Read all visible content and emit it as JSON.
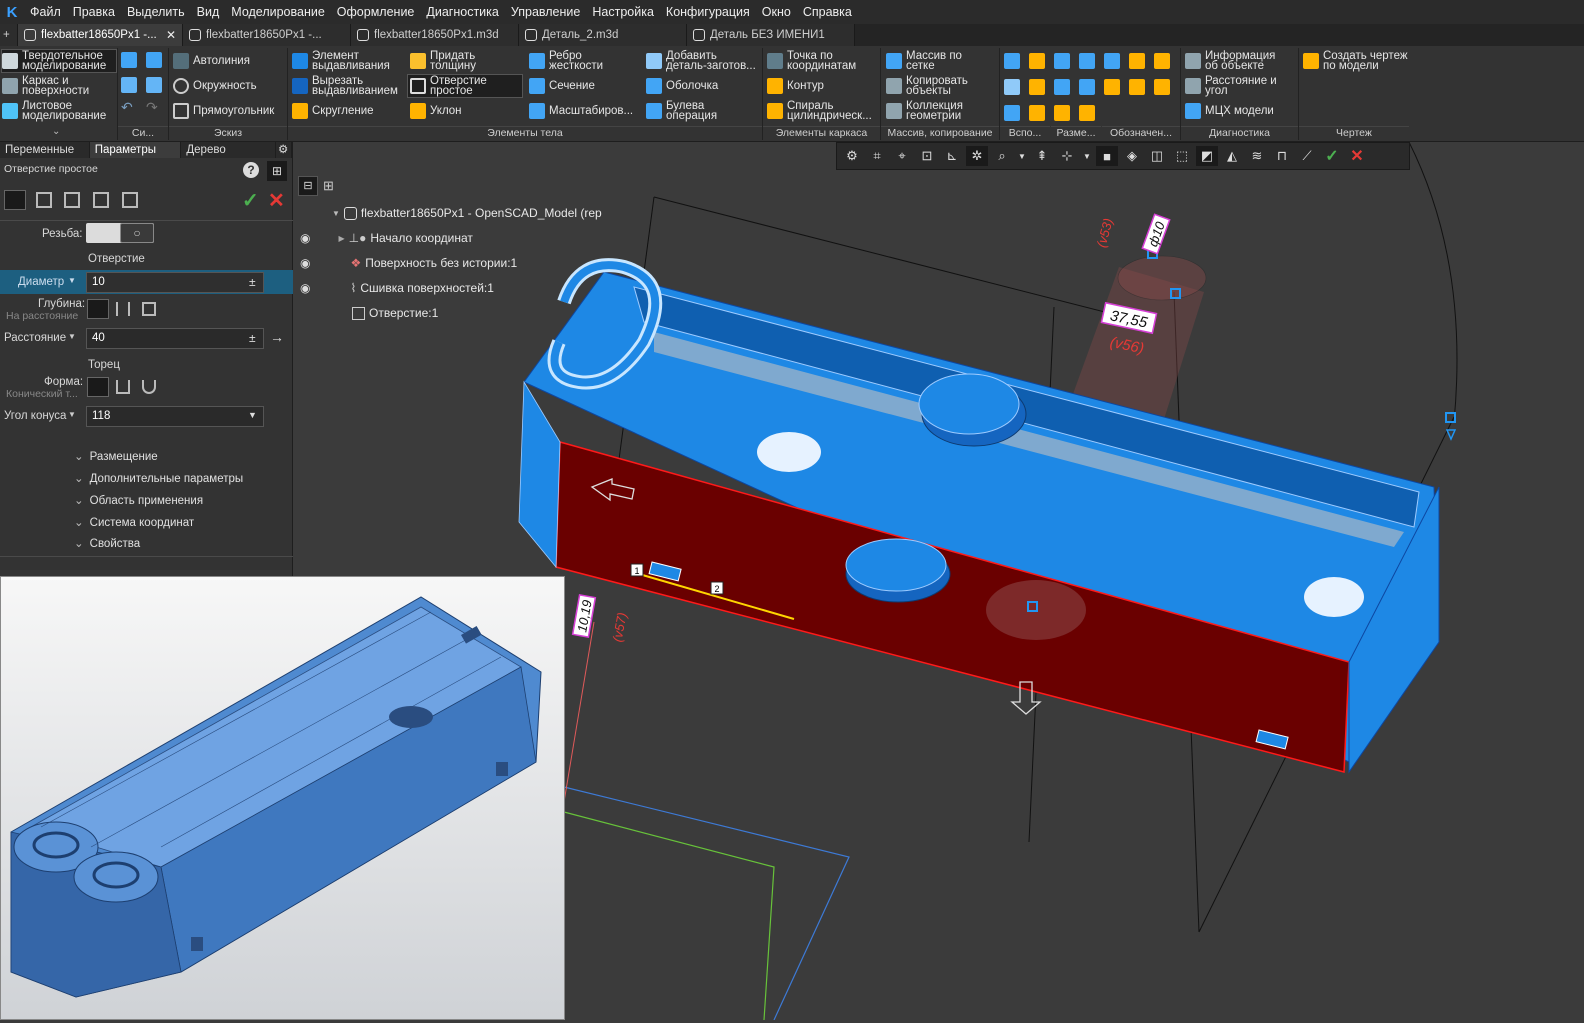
{
  "menu": [
    "Файл",
    "Правка",
    "Выделить",
    "Вид",
    "Моделирование",
    "Оформление",
    "Диагностика",
    "Управление",
    "Настройка",
    "Конфигурация",
    "Окно",
    "Справка"
  ],
  "tabs": [
    "flexbatter18650Px1 -...",
    "flexbatter18650Px1 -...",
    "flexbatter18650Px1.m3d",
    "Деталь_2.m3d",
    "Деталь БЕЗ ИМЕНИ1"
  ],
  "ribbon": {
    "modes": [
      "Твердотельное моделирование",
      "Каркас и поверхности",
      "Листовое моделирование"
    ],
    "sketch": [
      "Автолиния",
      "Окружность",
      "Прямоугольник"
    ],
    "body1": [
      "Элемент выдавливания",
      "Вырезать выдавливанием",
      "Скругление"
    ],
    "body2": [
      "Придать толщину",
      "Отверстие простое",
      "Уклон"
    ],
    "body3": [
      "Ребро жесткости",
      "Сечение",
      "Масштабиров..."
    ],
    "body4": [
      "Добавить деталь-заготов...",
      "Оболочка",
      "Булева операция"
    ],
    "frame": [
      "Точка по координатам",
      "Контур",
      "Спираль цилиндрическ..."
    ],
    "array": [
      "Массив по сетке",
      "Копировать объекты",
      "Коллекция геометрии"
    ],
    "diag": [
      "Информация об объекте",
      "Расстояние и угол",
      "МЦХ модели"
    ],
    "drawing": [
      "Создать чертеж по модели"
    ],
    "groups": [
      "Си...",
      "Эскиз",
      "Элементы тела",
      "Элементы каркаса",
      "Массив, копирование",
      "Вспо...",
      "Разме...",
      "Обозначен...",
      "Диагностика",
      "Чертеж"
    ]
  },
  "panel": {
    "tabs": [
      "Переменные",
      "Параметры",
      "Дерево"
    ],
    "title": "Отверстие простое",
    "thread_label": "Резьба:",
    "hole_header": "Отверстие",
    "diameter_label": "Диаметр",
    "diameter_value": "10",
    "depth_label": "Глубина:",
    "depth_sub": "На расстояние",
    "distance_label": "Расстояние",
    "distance_value": "40",
    "end_header": "Торец",
    "shape_label": "Форма:",
    "shape_sub": "Конический т...",
    "cone_label": "Угол конуса",
    "cone_value": "118",
    "sections": [
      "Размещение",
      "Дополнительные параметры",
      "Область применения",
      "Система координат",
      "Свойства"
    ]
  },
  "tree": {
    "root": "flexbatter18650Px1 - OpenSCAD_Model (rep",
    "items": [
      "Начало координат",
      "Поверхность без истории:1",
      "Сшивка поверхностей:1",
      "Отверстие:1"
    ]
  },
  "dims": {
    "phi": "ф10",
    "v53": "(v53)",
    "d1": "37,55",
    "v56": "(v56)",
    "d2": "10,19",
    "v57": "(v57)",
    "p1": "1",
    "p2": "2"
  },
  "colors": {
    "accent": "#1e88e5",
    "face": "#6a0000",
    "model": "#1e90ff"
  }
}
